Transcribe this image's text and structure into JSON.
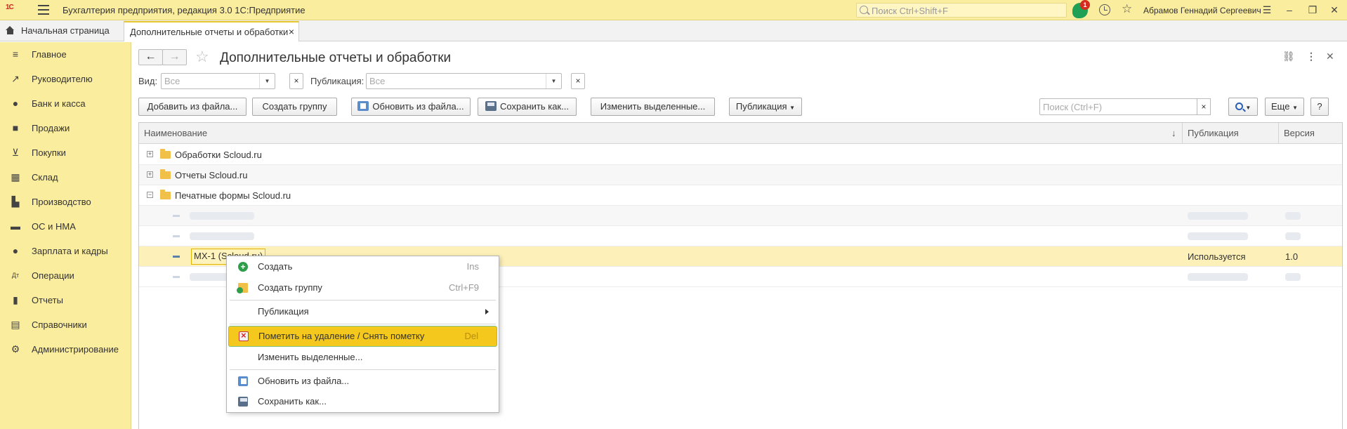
{
  "topbar": {
    "logo": "1С",
    "title": "Бухгалтерия предприятия, редакция 3.0 1С:Предприятие",
    "search_placeholder": "Поиск Ctrl+Shift+F",
    "notifications_count": "1",
    "user": "Абрамов Геннадий Сергеевич"
  },
  "tabs": {
    "home": "Начальная страница",
    "active": "Дополнительные отчеты и обработки"
  },
  "sidebar": {
    "items": [
      {
        "label": "Главное",
        "icon": "menu-icon"
      },
      {
        "label": "Руководителю",
        "icon": "trend-icon"
      },
      {
        "label": "Банк и касса",
        "icon": "coin-icon"
      },
      {
        "label": "Продажи",
        "icon": "bag-icon"
      },
      {
        "label": "Покупки",
        "icon": "cart-icon"
      },
      {
        "label": "Склад",
        "icon": "warehouse-icon"
      },
      {
        "label": "Производство",
        "icon": "factory-icon"
      },
      {
        "label": "ОС и НМА",
        "icon": "truck-icon"
      },
      {
        "label": "Зарплата и кадры",
        "icon": "person-icon"
      },
      {
        "label": "Операции",
        "icon": "dt-kt-icon"
      },
      {
        "label": "Отчеты",
        "icon": "chart-icon"
      },
      {
        "label": "Справочники",
        "icon": "book-icon"
      },
      {
        "label": "Администрирование",
        "icon": "gear-icon"
      }
    ]
  },
  "form": {
    "title": "Дополнительные отчеты и обработки",
    "filters": {
      "view_label": "Вид:",
      "view_placeholder": "Все",
      "publication_label": "Публикация:",
      "publication_placeholder": "Все"
    },
    "toolbar": {
      "add_from_file": "Добавить из файла...",
      "create_group": "Создать группу",
      "update_from_file": "Обновить из файла...",
      "save_as": "Сохранить как...",
      "change_selected": "Изменить выделенные...",
      "publication": "Публикация",
      "search_placeholder": "Поиск (Ctrl+F)",
      "more": "Еще",
      "help": "?"
    },
    "table": {
      "columns": [
        "Наименование",
        "Публикация",
        "Версия"
      ],
      "rows": [
        {
          "name": "Обработки Scloud.ru",
          "type": "folder",
          "expanded": false
        },
        {
          "name": "Отчеты Scloud.ru",
          "type": "folder",
          "expanded": false
        },
        {
          "name": "Печатные формы Scloud.ru",
          "type": "folder",
          "expanded": true
        },
        {
          "name": "МХ-1 (Scloud.ru)",
          "type": "item",
          "publication": "Используется",
          "version": "1.0",
          "selected": true
        }
      ]
    }
  },
  "context_menu": {
    "items": [
      {
        "label": "Создать",
        "shortcut": "Ins"
      },
      {
        "label": "Создать группу",
        "shortcut": "Ctrl+F9"
      },
      {
        "label": "Публикация",
        "shortcut": ""
      },
      {
        "label": "Пометить на удаление / Снять пометку",
        "shortcut": "Del"
      },
      {
        "label": "Изменить выделенные...",
        "shortcut": ""
      },
      {
        "label": "Обновить из файла...",
        "shortcut": ""
      },
      {
        "label": "Сохранить как...",
        "shortcut": ""
      }
    ]
  }
}
